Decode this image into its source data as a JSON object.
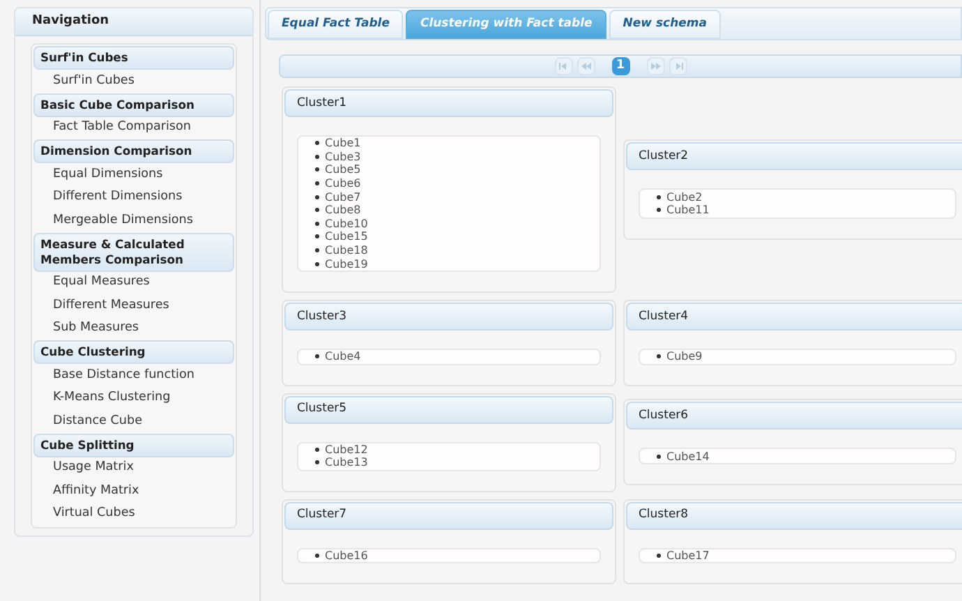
{
  "navigation": {
    "title": "Navigation",
    "sections": [
      {
        "title": "Surf'in Cubes",
        "items": [
          "Surf'in Cubes"
        ]
      },
      {
        "title": "Basic Cube Comparison",
        "items": [
          "Fact Table Comparison"
        ]
      },
      {
        "title": "Dimension Comparison",
        "items": [
          "Equal Dimensions",
          "Different Dimensions",
          "Mergeable Dimensions"
        ]
      },
      {
        "title": "Measure & Calculated Members Comparison",
        "items": [
          "Equal Measures",
          "Different Measures",
          "Sub Measures"
        ]
      },
      {
        "title": "Cube Clustering",
        "items": [
          "Base Distance function",
          "K-Means Clustering",
          "Distance Cube"
        ]
      },
      {
        "title": "Cube Splitting",
        "items": [
          "Usage Matrix",
          "Affinity Matrix",
          "Virtual Cubes"
        ]
      }
    ]
  },
  "tabs": [
    {
      "label": "Equal Fact Table",
      "selected": false
    },
    {
      "label": "Clustering with Fact table",
      "selected": true
    },
    {
      "label": "New schema",
      "selected": false
    }
  ],
  "paginator": {
    "pages": [
      {
        "label": "1",
        "selected": true
      }
    ]
  },
  "clusters": [
    {
      "title": "Cluster1",
      "cubes": [
        "Cube1",
        "Cube3",
        "Cube5",
        "Cube6",
        "Cube7",
        "Cube8",
        "Cube10",
        "Cube15",
        "Cube18",
        "Cube19"
      ]
    },
    {
      "title": "Cluster2",
      "cubes": [
        "Cube2",
        "Cube11"
      ]
    },
    {
      "title": "Cluster3",
      "cubes": [
        "Cube4"
      ]
    },
    {
      "title": "Cluster4",
      "cubes": [
        "Cube9"
      ]
    },
    {
      "title": "Cluster5",
      "cubes": [
        "Cube12",
        "Cube13"
      ]
    },
    {
      "title": "Cluster6",
      "cubes": [
        "Cube14"
      ]
    },
    {
      "title": "Cluster7",
      "cubes": [
        "Cube16"
      ]
    },
    {
      "title": "Cluster8",
      "cubes": [
        "Cube17"
      ]
    }
  ]
}
